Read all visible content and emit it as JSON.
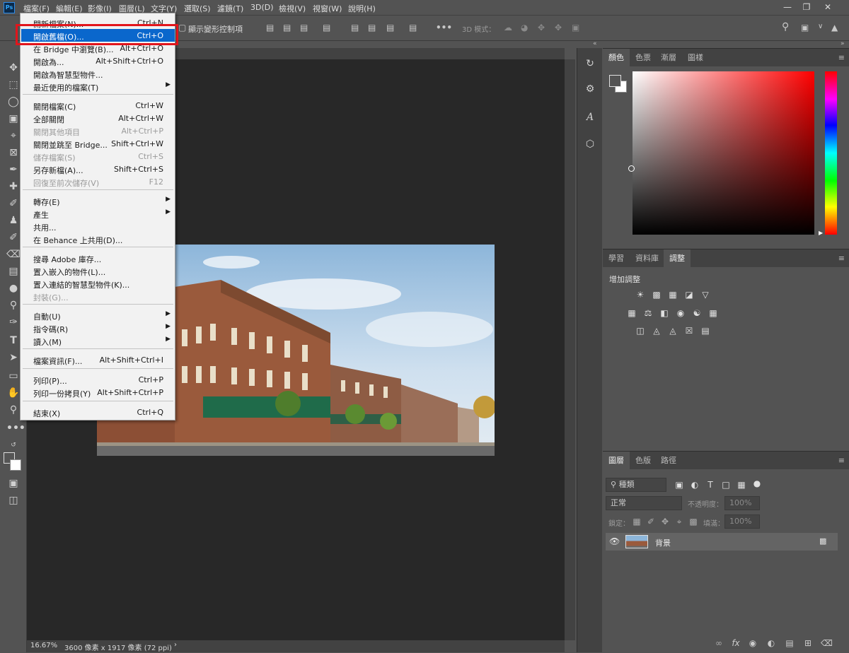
{
  "app": {
    "logo": "Ps"
  },
  "menubar": {
    "items": [
      "檔案(F)",
      "編輯(E)",
      "影像(I)",
      "圖層(L)",
      "文字(Y)",
      "選取(S)",
      "濾鏡(T)",
      "3D(D)",
      "檢視(V)",
      "視窗(W)",
      "說明(H)"
    ]
  },
  "options_bar": {
    "show_transform_label": "顯示變形控制項",
    "mode_3d_label": "3D 模式："
  },
  "file_menu": {
    "rows": [
      {
        "label": "開新檔案(N)...",
        "shortcut": "Ctrl+N",
        "state": "normal"
      },
      {
        "label": "開啟舊檔(O)...",
        "shortcut": "Ctrl+O",
        "state": "highlighted"
      },
      {
        "label": "在 Bridge 中瀏覽(B)...",
        "shortcut": "Alt+Ctrl+O",
        "state": "normal"
      },
      {
        "label": "開啟為...",
        "shortcut": "Alt+Shift+Ctrl+O",
        "state": "normal"
      },
      {
        "label": "開啟為智慧型物件...",
        "shortcut": "",
        "state": "normal"
      },
      {
        "label": "最近使用的檔案(T)",
        "shortcut": "",
        "state": "submenu"
      },
      {
        "label": "關閉檔案(C)",
        "shortcut": "Ctrl+W",
        "state": "normal"
      },
      {
        "label": "全部關閉",
        "shortcut": "Alt+Ctrl+W",
        "state": "normal"
      },
      {
        "label": "關閉其他項目",
        "shortcut": "Alt+Ctrl+P",
        "state": "disabled"
      },
      {
        "label": "關閉並跳至 Bridge...",
        "shortcut": "Shift+Ctrl+W",
        "state": "normal"
      },
      {
        "label": "儲存檔案(S)",
        "shortcut": "Ctrl+S",
        "state": "disabled"
      },
      {
        "label": "另存新檔(A)...",
        "shortcut": "Shift+Ctrl+S",
        "state": "normal"
      },
      {
        "label": "回復至前次儲存(V)",
        "shortcut": "F12",
        "state": "disabled"
      },
      {
        "label": "轉存(E)",
        "shortcut": "",
        "state": "submenu"
      },
      {
        "label": "產生",
        "shortcut": "",
        "state": "submenu"
      },
      {
        "label": "共用...",
        "shortcut": "",
        "state": "normal"
      },
      {
        "label": "在 Behance 上共用(D)...",
        "shortcut": "",
        "state": "normal"
      },
      {
        "label": "搜尋 Adobe 庫存...",
        "shortcut": "",
        "state": "normal"
      },
      {
        "label": "置入嵌入的物件(L)...",
        "shortcut": "",
        "state": "normal"
      },
      {
        "label": "置入連結的智慧型物件(K)...",
        "shortcut": "",
        "state": "normal"
      },
      {
        "label": "封裝(G)...",
        "shortcut": "",
        "state": "disabled"
      },
      {
        "label": "自動(U)",
        "shortcut": "",
        "state": "submenu"
      },
      {
        "label": "指令碼(R)",
        "shortcut": "",
        "state": "submenu"
      },
      {
        "label": "讀入(M)",
        "shortcut": "",
        "state": "submenu"
      },
      {
        "label": "檔案資訊(F)...",
        "shortcut": "Alt+Shift+Ctrl+I",
        "state": "normal"
      },
      {
        "label": "列印(P)...",
        "shortcut": "Ctrl+P",
        "state": "normal"
      },
      {
        "label": "列印一份拷貝(Y)",
        "shortcut": "Alt+Shift+Ctrl+P",
        "state": "normal"
      },
      {
        "label": "結束(X)",
        "shortcut": "Ctrl+Q",
        "state": "normal"
      }
    ]
  },
  "status_bar": {
    "zoom": "16.67%",
    "doc_info": "3600 像素 x 1917 像素 (72 ppi)"
  },
  "color_panel": {
    "tabs": [
      "顏色",
      "色票",
      "漸層",
      "圖樣"
    ],
    "hue_color": "#ff0000"
  },
  "adjust_panel": {
    "tabs": [
      "學習",
      "資料庫",
      "調整"
    ],
    "heading": "增加調整"
  },
  "layers_panel": {
    "tabs": [
      "圖層",
      "色版",
      "路徑"
    ],
    "filter_kind": "種類",
    "blend_mode": "正常",
    "opacity_label": "不透明度：",
    "opacity_value": "100%",
    "lock_label": "鎖定：",
    "fill_label": "填滿：",
    "fill_value": "100%",
    "layer_name": "背景"
  }
}
